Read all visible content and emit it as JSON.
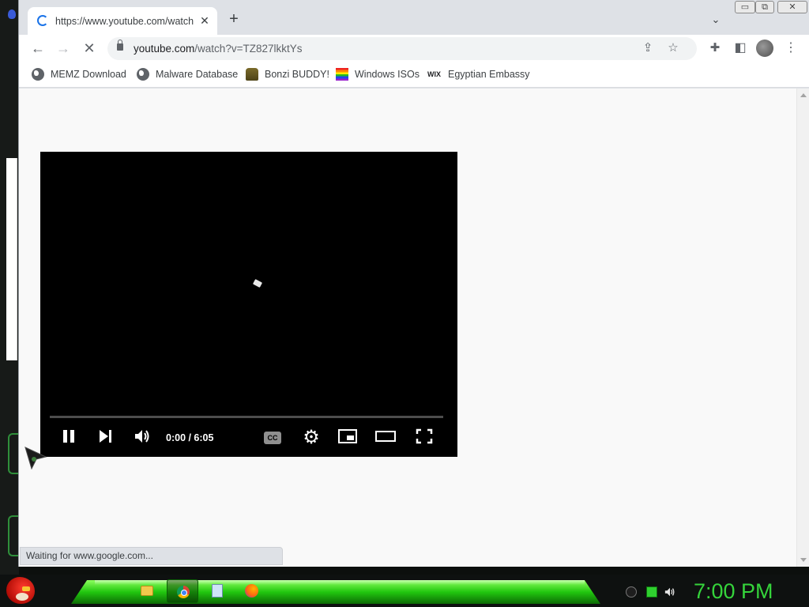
{
  "browser": {
    "tab": {
      "title": "https://www.youtube.com/watch",
      "loading": true
    },
    "omnibox": {
      "host": "youtube.com",
      "path": "/watch?v=TZ827lkktYs"
    },
    "window_controls": [
      "minimize",
      "restore",
      "close"
    ]
  },
  "bookmarks": [
    {
      "label": "MEMZ Download",
      "icon": "globe-icon"
    },
    {
      "label": "Malware Database",
      "icon": "globe-icon"
    },
    {
      "label": "Bonzi BUDDY!",
      "icon": "bonzi-icon"
    },
    {
      "label": "Windows ISOs",
      "icon": "rainbow-flag-icon"
    },
    {
      "label": "Egyptian Embassy",
      "icon": "wix-icon",
      "icon_text": "WIX"
    }
  ],
  "player": {
    "time": "0:00 / 6:05",
    "cc_label": "CC",
    "controls": [
      "pause",
      "next",
      "volume",
      "captions",
      "settings",
      "miniplayer",
      "theater",
      "fullscreen"
    ]
  },
  "status_text": "Waiting for www.google.com...",
  "taskbar": {
    "apps": [
      "file-explorer",
      "chrome",
      "notepad",
      "firefox"
    ],
    "clock": "7:00 PM",
    "accent_color": "#35d43b"
  }
}
